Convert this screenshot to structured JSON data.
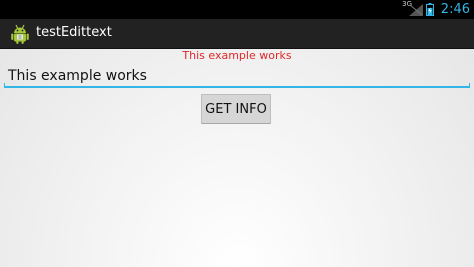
{
  "status_bar": {
    "network_type": "3G",
    "time": "2:46",
    "icons": [
      "signal-icon",
      "battery-icon"
    ],
    "accent_color": "#33b5e5"
  },
  "action_bar": {
    "icon": "android-icon",
    "title": "testEdittext"
  },
  "main": {
    "echo_text": "This example works",
    "edit_value": "This example works",
    "button_label": "GET INFO"
  },
  "colors": {
    "echo_text": "#e02828",
    "underline": "#33b5e5",
    "action_bar_bg": "#222222"
  }
}
